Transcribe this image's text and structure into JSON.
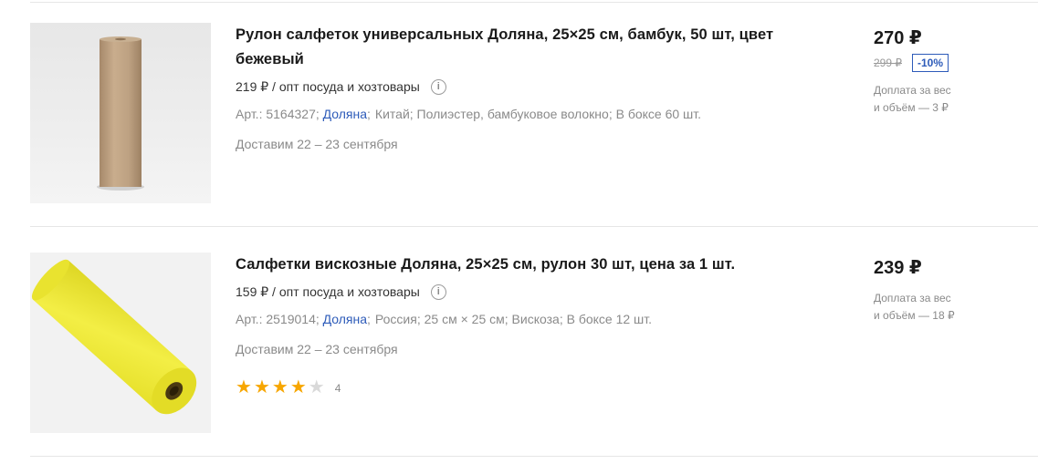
{
  "products": [
    {
      "title": "Рулон салфеток универсальных Доляна, 25×25 см, бамбук, 50 шт, цвет бежевый",
      "opt_price": "219 ₽ / опт посуда и хозтовары",
      "article": "Арт.: 5164327;",
      "brand": "Доляна",
      "attrs": [
        "Китай;",
        "Полиэстер, бамбуковое волокно;",
        "В боксе 60 шт."
      ],
      "delivery": "Доставим 22 – 23 сентября",
      "price": "270 ₽",
      "old_price": "299 ₽",
      "discount": "-10%",
      "extra_line1": "Доплата за вес",
      "extra_line2": "и объём — 3 ₽",
      "image_icon": "beige-napkin-roll"
    },
    {
      "title": "Салфетки вискозные Доляна, 25×25 см, рулон 30 шт, цена за 1 шт.",
      "opt_price": "159 ₽ / опт посуда и хозтовары",
      "article": "Арт.: 2519014;",
      "brand": "Доляна",
      "attrs": [
        "Россия;",
        "25 см × 25 см;",
        "Вискоза;",
        "В боксе 12 шт."
      ],
      "delivery": "Доставим 22 – 23 сентября",
      "rating": 4,
      "rating_max": 5,
      "rating_label": "4",
      "price": "239 ₽",
      "extra_line1": "Доплата за вес",
      "extra_line2": "и объём — 18 ₽",
      "image_icon": "yellow-napkin-roll"
    }
  ],
  "info_icon_glyph": "i",
  "colors": {
    "brand_link": "#2d5bb9",
    "star": "#f7a600",
    "muted": "#8a8a8a"
  }
}
